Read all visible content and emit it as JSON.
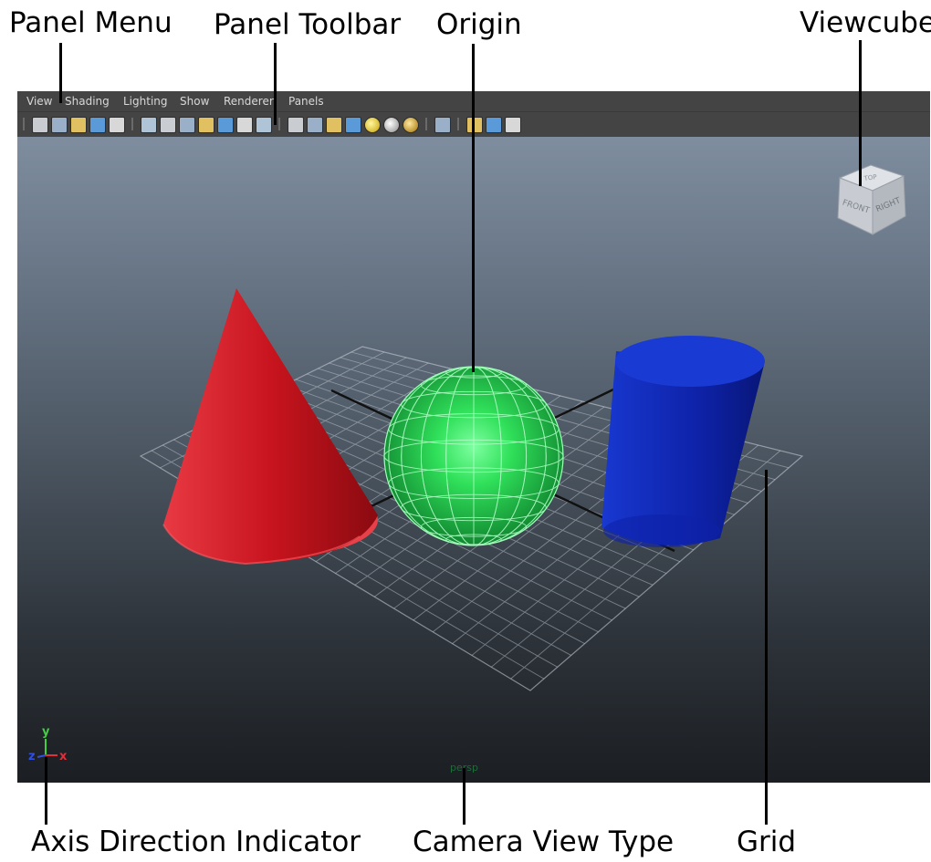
{
  "callouts": {
    "panel_menu": "Panel Menu",
    "panel_toolbar": "Panel Toolbar",
    "origin": "Origin",
    "viewcube": "Viewcube",
    "axis_indicator": "Axis Direction Indicator",
    "camera_view_type": "Camera View Type",
    "grid": "Grid"
  },
  "menu": {
    "items": [
      {
        "label": "View"
      },
      {
        "label": "Shading"
      },
      {
        "label": "Lighting"
      },
      {
        "label": "Show"
      },
      {
        "label": "Renderer"
      },
      {
        "label": "Panels"
      }
    ]
  },
  "toolbar": {
    "icons": [
      "select-camera-icon",
      "camera-attributes-icon",
      "bookmarks-icon",
      "image-plane-icon",
      "2d-pan-zoom-icon",
      "grid-toggle-icon",
      "film-gate-icon",
      "resolution-gate-icon",
      "gate-mask-icon",
      "field-chart-icon",
      "safe-action-icon",
      "safe-title-icon",
      "wireframe-icon",
      "smooth-shade-icon",
      "wireframe-on-shaded-icon",
      "textured-icon",
      "default-lighting-icon",
      "all-lights-icon",
      "shadows-icon",
      "isolate-select-icon",
      "xray-icon",
      "xray-joints-icon",
      "xray-components-icon"
    ]
  },
  "viewcube": {
    "front_label": "FRONT",
    "right_label": "RIGHT",
    "top_label": "TOP"
  },
  "axis": {
    "x_label": "x",
    "y_label": "y",
    "z_label": "z"
  },
  "camera": {
    "view_type": "persp"
  },
  "colors": {
    "cone": "#d8202a",
    "sphere": "#2fd85a",
    "cylinder": "#1428b4",
    "menu_bg": "#444444",
    "axis_x": "#e0303a",
    "axis_y": "#40d040",
    "axis_z": "#3050e0"
  }
}
